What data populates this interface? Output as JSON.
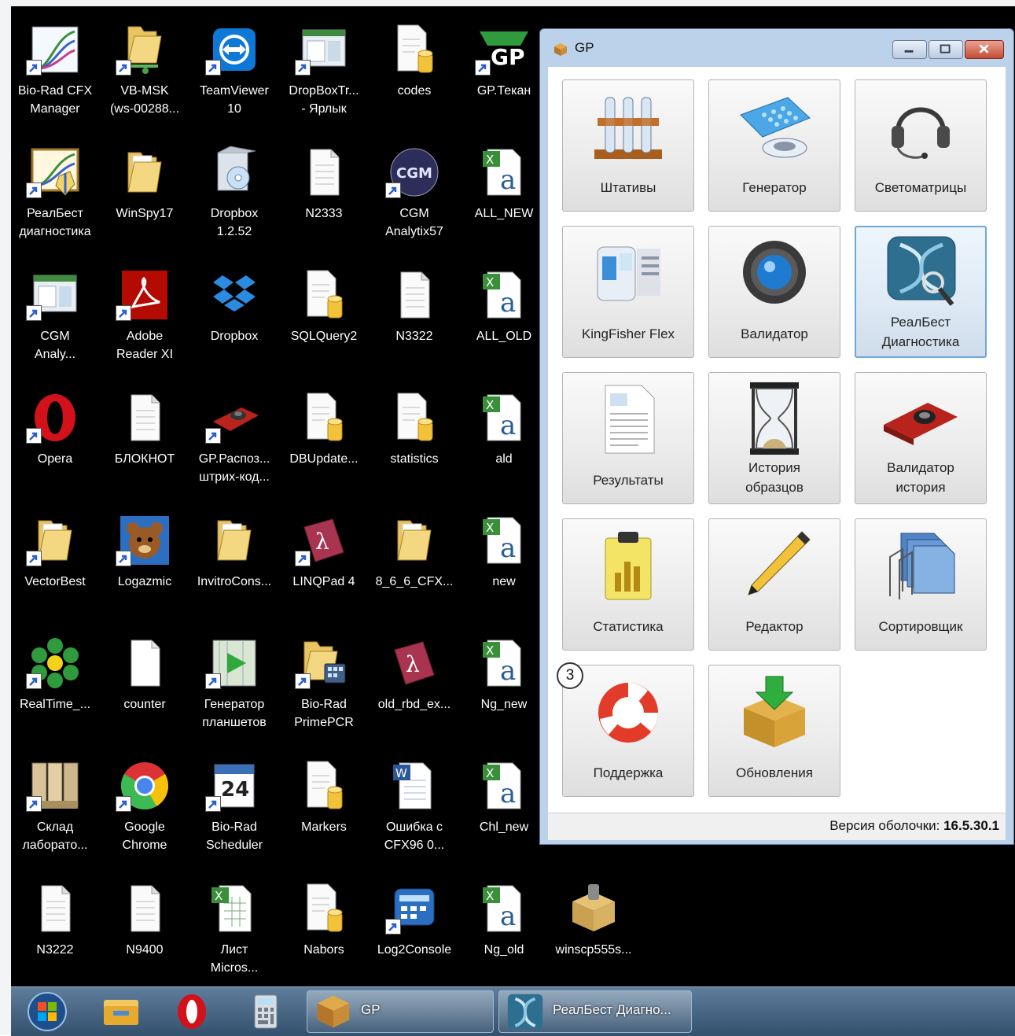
{
  "desktop": {
    "icons": [
      {
        "label": "Bio-Rad CFX\nManager",
        "icon": "biorad-cfx-icon",
        "shortcut": true
      },
      {
        "label": "VB-MSK\n(ws-00288...",
        "icon": "network-folder-icon",
        "shortcut": true
      },
      {
        "label": "TeamViewer\n10",
        "icon": "teamviewer-icon",
        "shortcut": true
      },
      {
        "label": "DropBoxTr...\n- Ярлык",
        "icon": "app-window-icon",
        "shortcut": true
      },
      {
        "label": "codes",
        "icon": "database-file-icon",
        "shortcut": false
      },
      {
        "label": "GP.Текан",
        "icon": "gp-tecan-icon",
        "shortcut": true
      },
      {
        "label": "РеалБест\nдиагностика",
        "icon": "realbest-diag-icon",
        "shortcut": true
      },
      {
        "label": "WinSpy17",
        "icon": "folder-icon",
        "shortcut": false
      },
      {
        "label": "Dropbox\n1.2.52",
        "icon": "installer-icon",
        "shortcut": false
      },
      {
        "label": "N2333",
        "icon": "text-file-icon",
        "shortcut": false
      },
      {
        "label": "CGM\nAnalytix57",
        "icon": "cgm-icon",
        "shortcut": true
      },
      {
        "label": "ALL_NEW",
        "icon": "excel-icon",
        "shortcut": false
      },
      {
        "label": "CGM\nAnaly...",
        "icon": "app-window-icon",
        "shortcut": true
      },
      {
        "label": "Adobe\nReader XI",
        "icon": "adobe-reader-icon",
        "shortcut": true
      },
      {
        "label": "Dropbox",
        "icon": "dropbox-icon",
        "shortcut": false
      },
      {
        "label": "SQLQuery2",
        "icon": "database-file-icon",
        "shortcut": false
      },
      {
        "label": "N3322",
        "icon": "text-file-icon",
        "shortcut": false
      },
      {
        "label": "ALL_OLD",
        "icon": "excel-icon",
        "shortcut": false
      },
      {
        "label": "Opera",
        "icon": "opera-icon",
        "shortcut": true
      },
      {
        "label": "БЛОКНОТ",
        "icon": "text-file-icon",
        "shortcut": false
      },
      {
        "label": "GP.Распоз...\nштрих-код...",
        "icon": "scanner-icon",
        "shortcut": true
      },
      {
        "label": "DBUpdate...",
        "icon": "database-file-icon",
        "shortcut": false
      },
      {
        "label": "statistics",
        "icon": "database-file-icon",
        "shortcut": false
      },
      {
        "label": "ald",
        "icon": "excel-icon",
        "shortcut": false
      },
      {
        "label": "VectorBest",
        "icon": "folder-icon",
        "shortcut": true
      },
      {
        "label": "Logazmic",
        "icon": "logazmic-icon",
        "shortcut": true
      },
      {
        "label": "InvitroCons...",
        "icon": "folder-icon",
        "shortcut": false
      },
      {
        "label": "LINQPad 4",
        "icon": "linqpad-icon",
        "shortcut": true
      },
      {
        "label": "8_6_6_CFX...",
        "icon": "folder-icon",
        "shortcut": false
      },
      {
        "label": "new",
        "icon": "excel-icon",
        "shortcut": false
      },
      {
        "label": "RealTime_...",
        "icon": "realtime-icon",
        "shortcut": true
      },
      {
        "label": "counter",
        "icon": "blank-file-icon",
        "shortcut": false
      },
      {
        "label": "Генератор\nпланшетов",
        "icon": "media-icon",
        "shortcut": true
      },
      {
        "label": "Bio-Rad\nPrimePCR",
        "icon": "folder-app-icon",
        "shortcut": true
      },
      {
        "label": "old_rbd_ex...",
        "icon": "linqpad-icon",
        "shortcut": false
      },
      {
        "label": "Ng_new",
        "icon": "excel-icon",
        "shortcut": false
      },
      {
        "label": "Склад\nлаборато...",
        "icon": "warehouse-icon",
        "shortcut": true
      },
      {
        "label": "Google\nChrome",
        "icon": "chrome-icon",
        "shortcut": true
      },
      {
        "label": "Bio-Rad\nScheduler",
        "icon": "calendar-icon",
        "shortcut": true
      },
      {
        "label": "Markers",
        "icon": "database-file-icon",
        "shortcut": false
      },
      {
        "label": "Ошибка с\nCFX96 0...",
        "icon": "word-icon",
        "shortcut": false
      },
      {
        "label": "Chl_new",
        "icon": "excel-icon",
        "shortcut": false
      },
      {
        "label": "N3222",
        "icon": "text-file-icon",
        "shortcut": false
      },
      {
        "label": "N9400",
        "icon": "text-file-icon",
        "shortcut": false
      },
      {
        "label": "Лист\nMicros...",
        "icon": "excel-sheet-icon",
        "shortcut": false
      },
      {
        "label": "Nabors",
        "icon": "database-file-icon",
        "shortcut": false
      },
      {
        "label": "Log2Console",
        "icon": "log2console-icon",
        "shortcut": true
      },
      {
        "label": "Ng_old",
        "icon": "excel-icon",
        "shortcut": false
      },
      {
        "label": "winscp555s...",
        "icon": "package-icon",
        "shortcut": false
      }
    ]
  },
  "gp_window": {
    "title": "GP",
    "tiles": [
      {
        "label": "Штативы",
        "icon": "racks-icon"
      },
      {
        "label": "Генератор",
        "icon": "plate-generator-icon"
      },
      {
        "label": "Светоматрицы",
        "icon": "headset-icon"
      },
      {
        "label": "KingFisher Flex",
        "icon": "kingfisher-icon"
      },
      {
        "label": "Валидатор",
        "icon": "validator-lens-icon"
      },
      {
        "label": "РеалБест\nДиагностика",
        "icon": "realbest-dna-icon",
        "active": true
      },
      {
        "label": "Результаты",
        "icon": "results-document-icon"
      },
      {
        "label": "История\nобразцов",
        "icon": "hourglass-icon"
      },
      {
        "label": "Валидатор\nистория",
        "icon": "validator-history-icon"
      },
      {
        "label": "Статистика",
        "icon": "statistics-clipboard-icon"
      },
      {
        "label": "Редактор",
        "icon": "pencil-icon"
      },
      {
        "label": "Сортировщик",
        "icon": "sorter-folder-icon"
      },
      {
        "label": "Поддержка",
        "icon": "lifebuoy-icon",
        "badge": "3"
      },
      {
        "label": "Обновления",
        "icon": "updates-box-icon"
      }
    ],
    "status": {
      "prefix": "Версия оболочки:",
      "version": "16.5.30.1"
    }
  },
  "taskbar": {
    "pinned": [
      "start-orb-icon",
      "explorer-icon",
      "opera-icon",
      "calculator-icon"
    ],
    "tasks": [
      {
        "label": "GP",
        "icon": "gp-box-icon"
      },
      {
        "label": "РеалБест Диагно...",
        "icon": "realbest-dna-icon"
      }
    ]
  }
}
